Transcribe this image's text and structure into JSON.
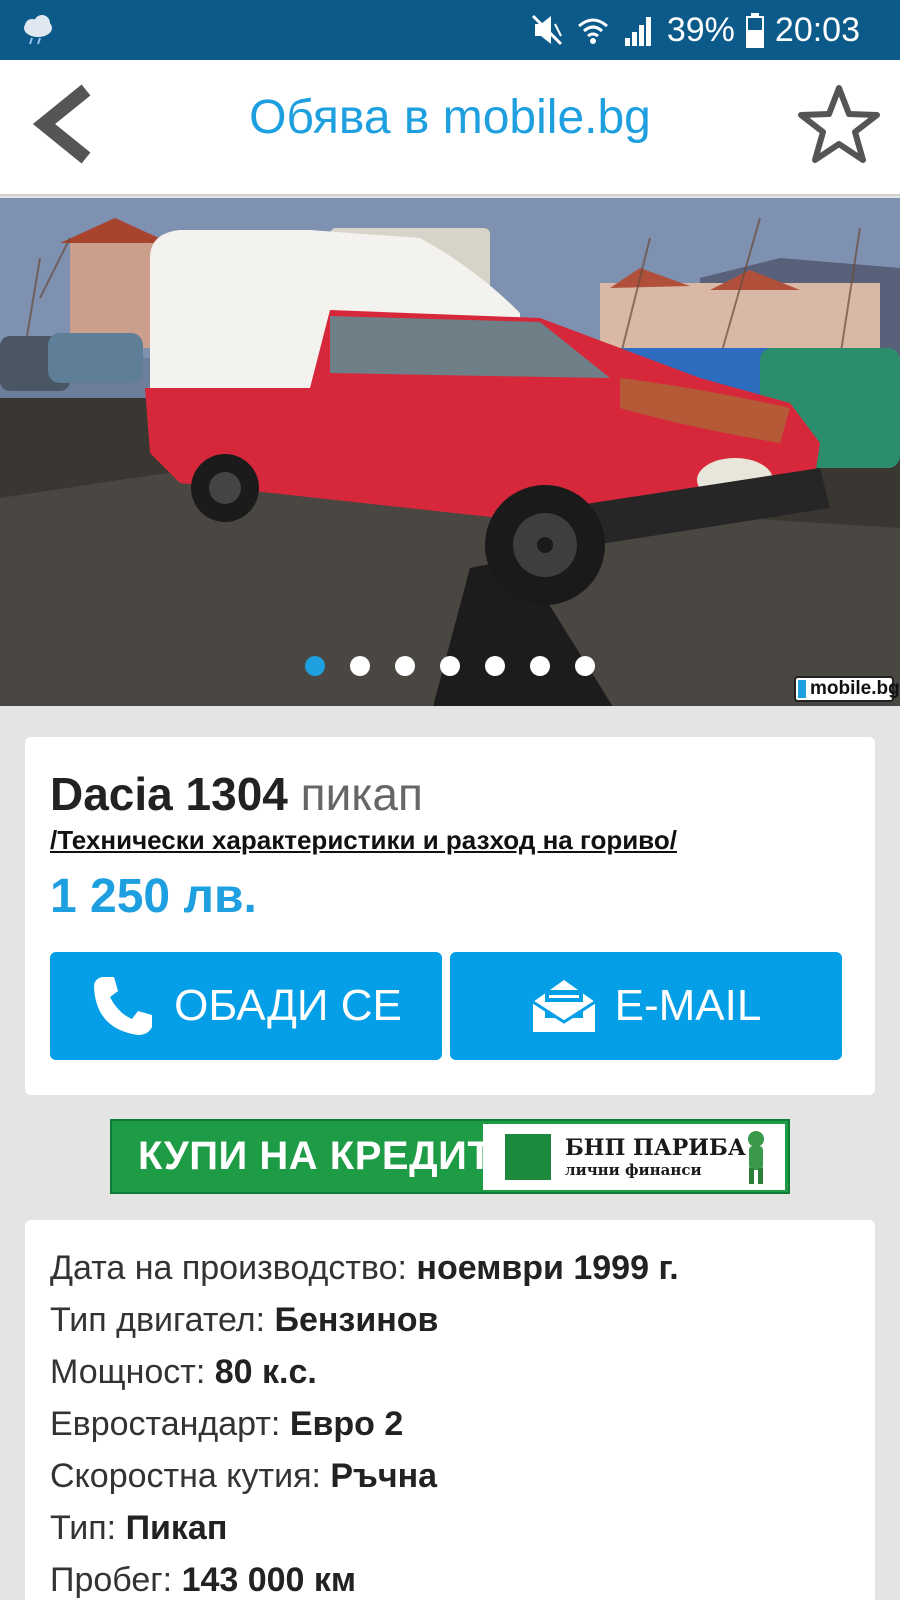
{
  "status_bar": {
    "battery": "39%",
    "time": "20:03",
    "icons": [
      "weather-icon",
      "mute-icon",
      "wifi-icon",
      "signal-icon",
      "battery-icon"
    ]
  },
  "header": {
    "title": "Обява в mobile.bg",
    "back_icon": "back-arrow-icon",
    "favorite_icon": "star-icon"
  },
  "gallery": {
    "total_images": 7,
    "active_index": 0,
    "watermark": "mobile.bg"
  },
  "listing": {
    "make_model": "Dacia 1304",
    "body_type": "пикап",
    "tech_link": "/Технически характеристики и разход на гориво/",
    "price": "1 250 лв."
  },
  "actions": {
    "call_label": "ОБАДИ СЕ",
    "email_label": "E-MAIL"
  },
  "banner": {
    "text": "КУПИ НА КРЕДИТ",
    "partner_line1": "БНП ПАРИБА",
    "partner_line2": "лични финанси"
  },
  "specs": [
    {
      "label": "Дата на производство:",
      "value": "ноември 1999 г."
    },
    {
      "label": "Тип двигател:",
      "value": "Бензинов"
    },
    {
      "label": "Мощност:",
      "value": "80 к.с."
    },
    {
      "label": "Евростандарт:",
      "value": "Евро 2"
    },
    {
      "label": "Скоростна кутия:",
      "value": "Ръчна"
    },
    {
      "label": "Тип:",
      "value": "Пикап"
    },
    {
      "label": "Пробег:",
      "value": "143 000 км"
    }
  ],
  "colors": {
    "accent": "#1e9fe0",
    "status_bar": "#0b5a8a",
    "button": "#059fe8",
    "banner_green": "#1e9b45",
    "background": "#e4e4e4"
  }
}
